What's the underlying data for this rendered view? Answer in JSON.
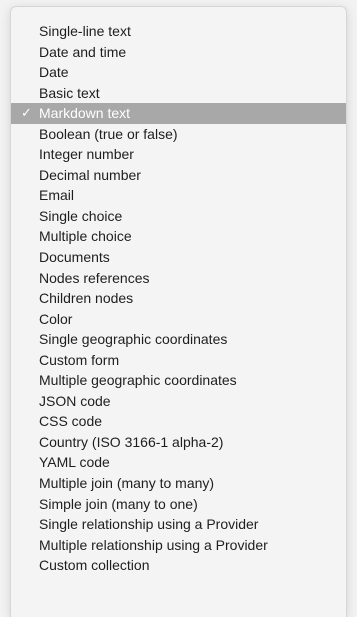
{
  "menu": {
    "items": [
      {
        "label": "Single-line text",
        "selected": false
      },
      {
        "label": "Date and time",
        "selected": false
      },
      {
        "label": "Date",
        "selected": false
      },
      {
        "label": "Basic text",
        "selected": false
      },
      {
        "label": "Markdown text",
        "selected": true
      },
      {
        "label": "Boolean (true or false)",
        "selected": false
      },
      {
        "label": "Integer number",
        "selected": false
      },
      {
        "label": "Decimal number",
        "selected": false
      },
      {
        "label": "Email",
        "selected": false
      },
      {
        "label": "Single choice",
        "selected": false
      },
      {
        "label": "Multiple choice",
        "selected": false
      },
      {
        "label": "Documents",
        "selected": false
      },
      {
        "label": "Nodes references",
        "selected": false
      },
      {
        "label": "Children nodes",
        "selected": false
      },
      {
        "label": "Color",
        "selected": false
      },
      {
        "label": "Single geographic coordinates",
        "selected": false
      },
      {
        "label": "Custom form",
        "selected": false
      },
      {
        "label": "Multiple geographic coordinates",
        "selected": false
      },
      {
        "label": "JSON code",
        "selected": false
      },
      {
        "label": "CSS code",
        "selected": false
      },
      {
        "label": "Country (ISO 3166-1 alpha-2)",
        "selected": false
      },
      {
        "label": "YAML code",
        "selected": false
      },
      {
        "label": "Multiple join (many to many)",
        "selected": false
      },
      {
        "label": "Simple join (many to one)",
        "selected": false
      },
      {
        "label": "Single relationship using a Provider",
        "selected": false
      },
      {
        "label": "Multiple relationship using a Provider",
        "selected": false
      },
      {
        "label": "Custom collection",
        "selected": false
      }
    ],
    "checkmark_glyph": "✓",
    "selected_background": "#a8a8a8",
    "selected_text_color": "#ffffff"
  }
}
